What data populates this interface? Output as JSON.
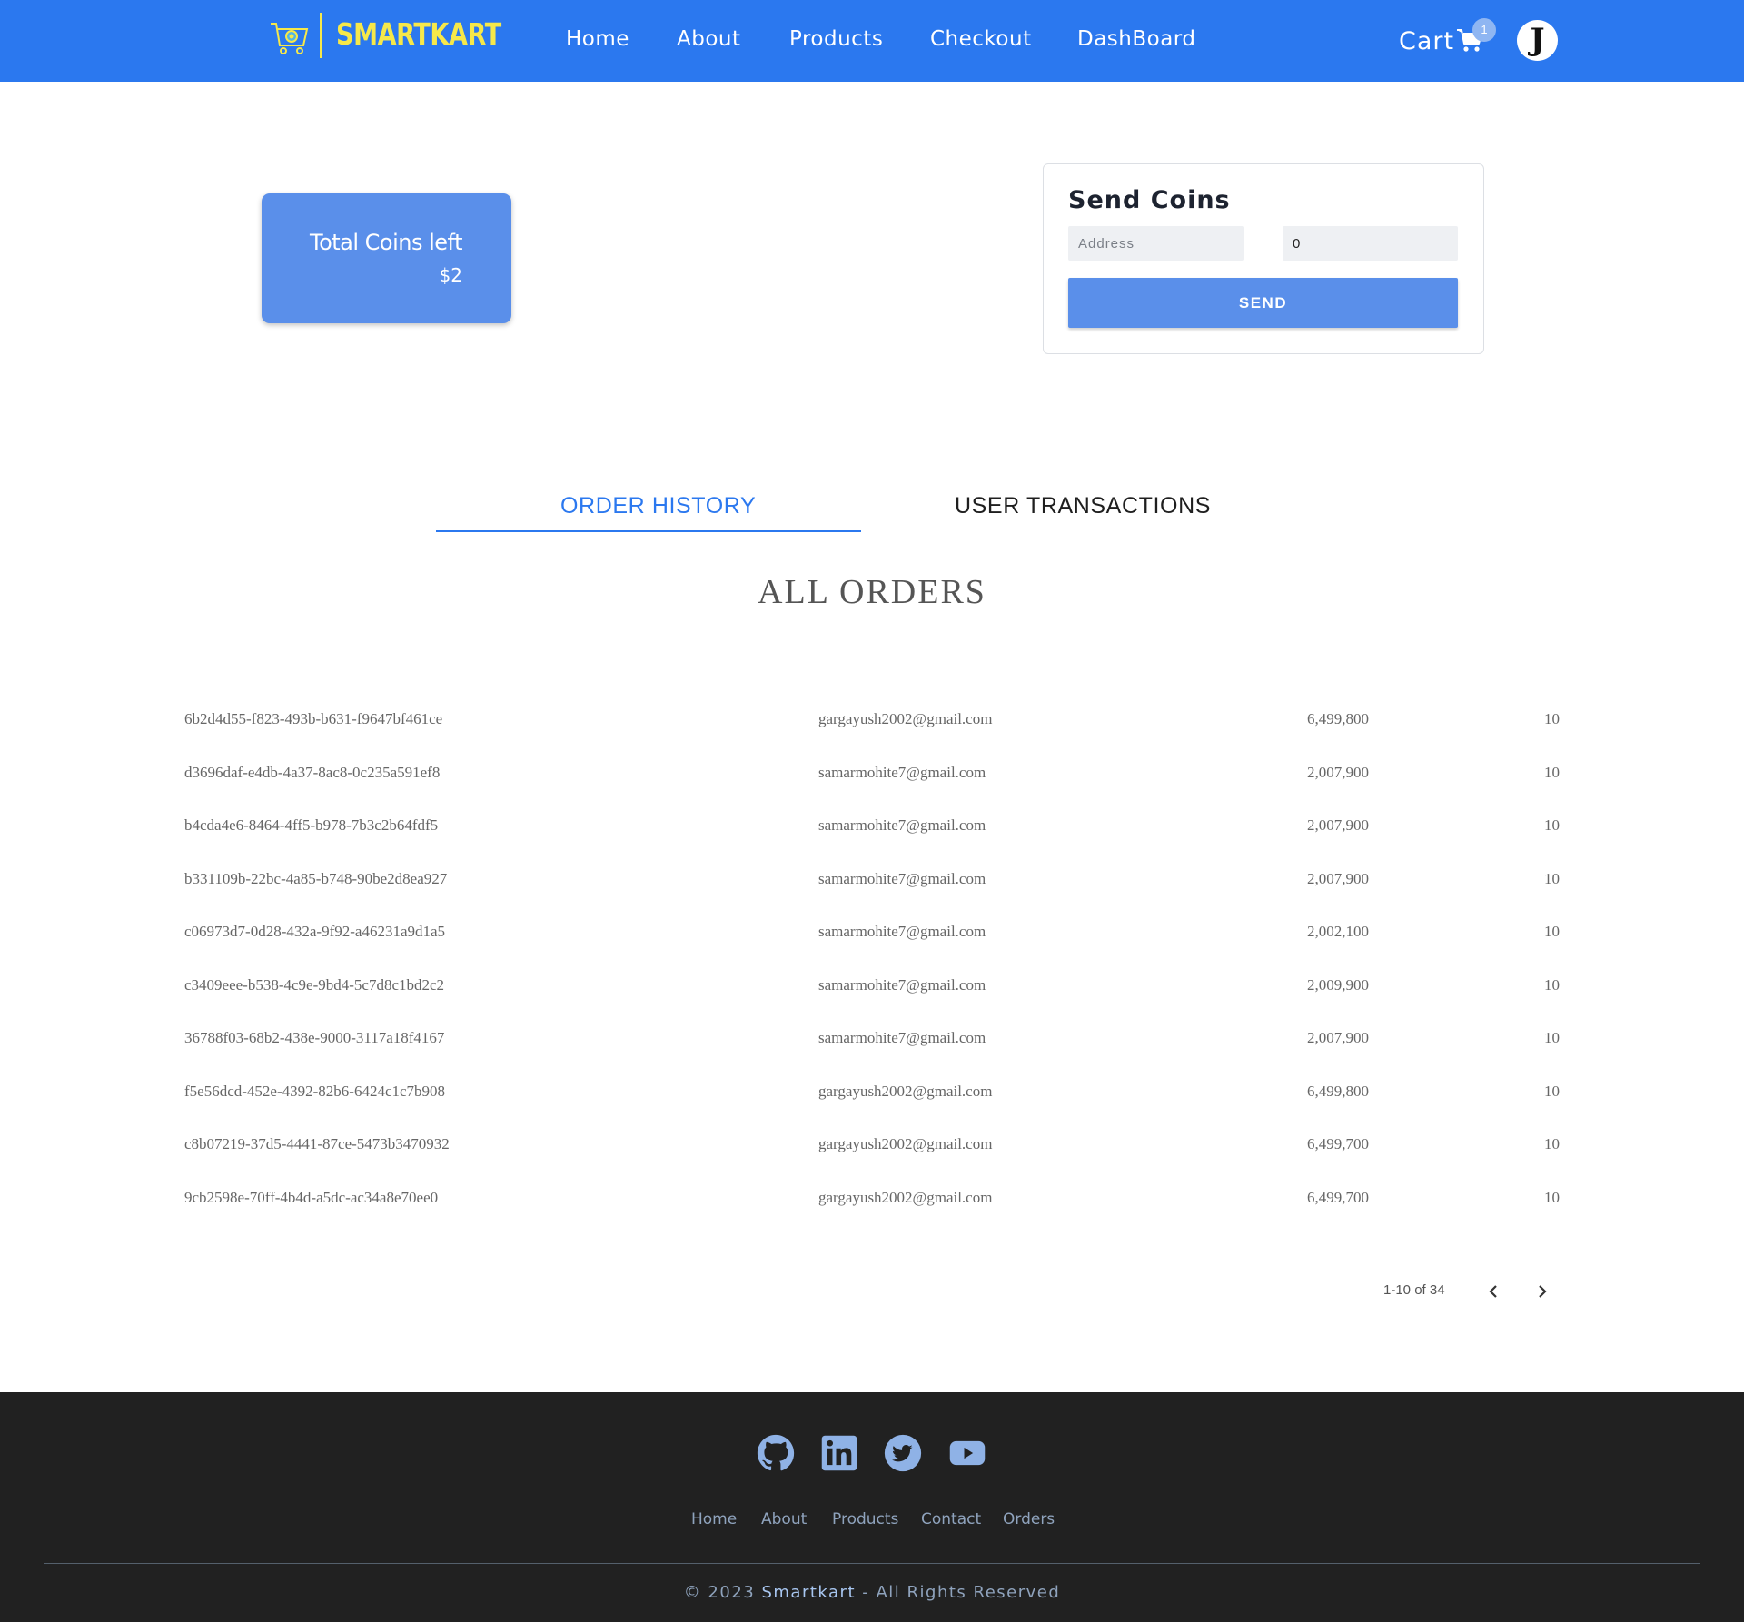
{
  "navbar": {
    "brand": "SMARTKART",
    "links": [
      "Home",
      "About",
      "Products",
      "Checkout",
      "DashBoard"
    ],
    "cart_label": "Cart",
    "cart_count": "1",
    "avatar_letter": "J",
    "icons": {
      "brand": "shopping-cart-logo-icon",
      "cart": "cart-icon"
    },
    "colors": {
      "bar": "#2b78ef",
      "brand": "#f6e84a"
    }
  },
  "coins": {
    "title": "Total Coins left",
    "value": "$2"
  },
  "send_coins": {
    "title": "Send Coins",
    "address_placeholder": "Address",
    "amount_value": "0",
    "button_label": "SEND"
  },
  "tabs": {
    "order_history": "ORDER HISTORY",
    "user_transactions": "USER TRANSACTIONS",
    "active": "ORDER HISTORY"
  },
  "orders": {
    "heading": "ALL ORDERS",
    "rows": [
      {
        "id": "6b2d4d55-f823-493b-b631-f9647bf461ce",
        "email": "gargayush2002@gmail.com",
        "amount": "6,499,800",
        "qty": "10"
      },
      {
        "id": "d3696daf-e4db-4a37-8ac8-0c235a591ef8",
        "email": "samarmohite7@gmail.com",
        "amount": "2,007,900",
        "qty": "10"
      },
      {
        "id": "b4cda4e6-8464-4ff5-b978-7b3c2b64fdf5",
        "email": "samarmohite7@gmail.com",
        "amount": "2,007,900",
        "qty": "10"
      },
      {
        "id": "b331109b-22bc-4a85-b748-90be2d8ea927",
        "email": "samarmohite7@gmail.com",
        "amount": "2,007,900",
        "qty": "10"
      },
      {
        "id": "c06973d7-0d28-432a-9f92-a46231a9d1a5",
        "email": "samarmohite7@gmail.com",
        "amount": "2,002,100",
        "qty": "10"
      },
      {
        "id": "c3409eee-b538-4c9e-9bd4-5c7d8c1bd2c2",
        "email": "samarmohite7@gmail.com",
        "amount": "2,009,900",
        "qty": "10"
      },
      {
        "id": "36788f03-68b2-438e-9000-3117a18f4167",
        "email": "samarmohite7@gmail.com",
        "amount": "2,007,900",
        "qty": "10"
      },
      {
        "id": "f5e56dcd-452e-4392-82b6-6424c1c7b908",
        "email": "gargayush2002@gmail.com",
        "amount": "6,499,800",
        "qty": "10"
      },
      {
        "id": "c8b07219-37d5-4441-87ce-5473b3470932",
        "email": "gargayush2002@gmail.com",
        "amount": "6,499,700",
        "qty": "10"
      },
      {
        "id": "9cb2598e-70ff-4b4d-a5dc-ac34a8e70ee0",
        "email": "gargayush2002@gmail.com",
        "amount": "6,499,700",
        "qty": "10"
      }
    ],
    "pagination": "1-10 of 34"
  },
  "footer": {
    "social_icons": [
      "github-icon",
      "linkedin-icon",
      "twitter-icon",
      "youtube-icon"
    ],
    "links": [
      "Home",
      "About",
      "Products",
      "Contact",
      "Orders"
    ],
    "copyright_prefix": "© 2023",
    "copyright_brand": "Smartkart",
    "copyright_suffix": "- All Rights Reserved"
  }
}
